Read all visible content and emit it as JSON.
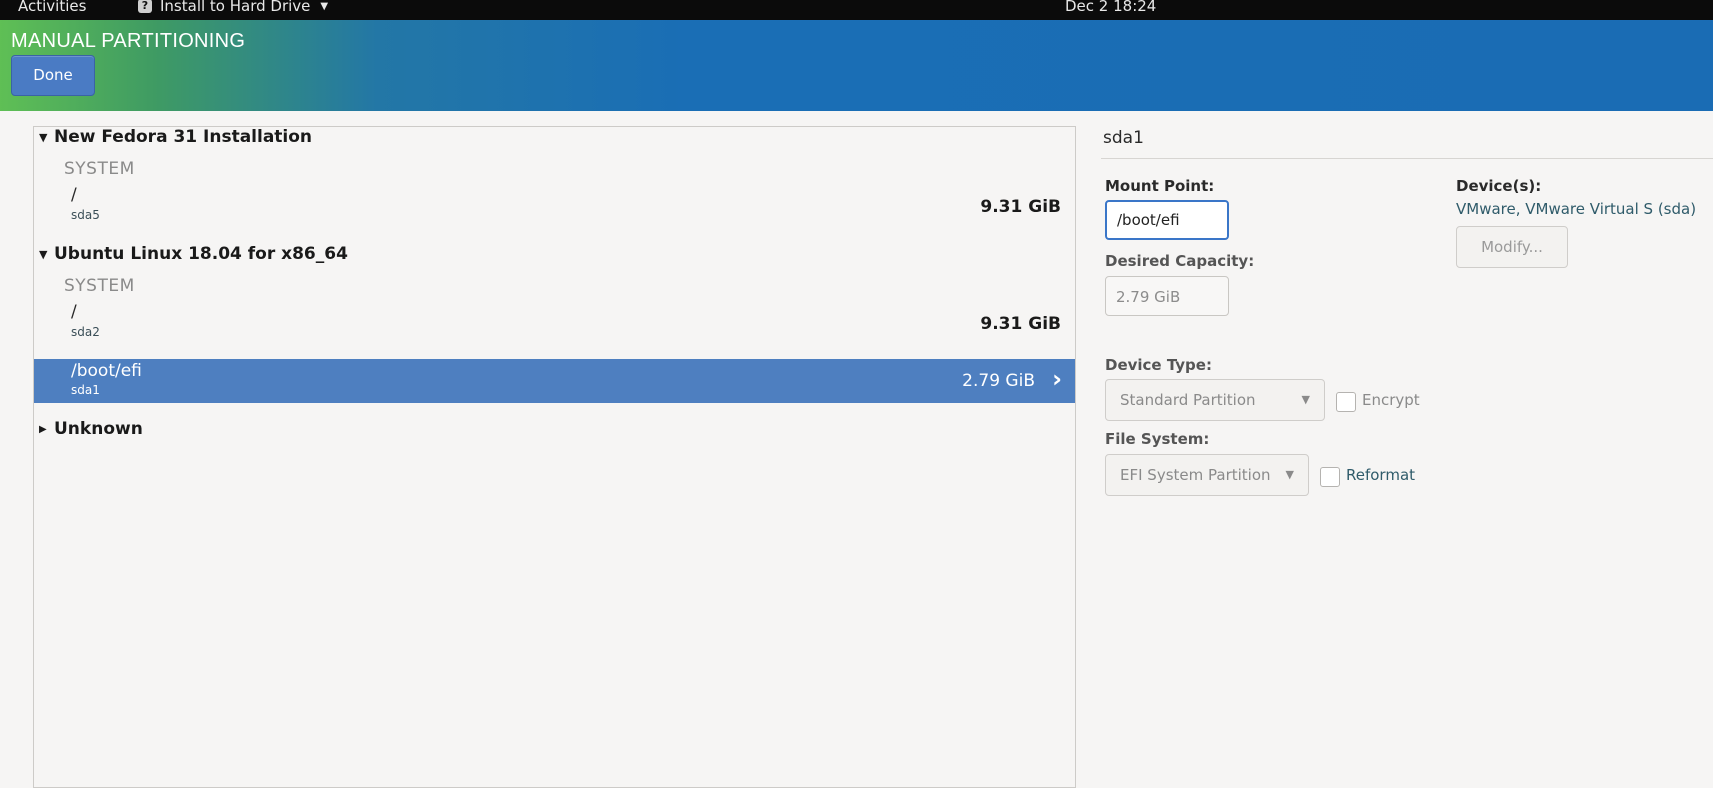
{
  "topbar": {
    "activities": "Activities",
    "app_name": "Install to Hard Drive",
    "clock": "Dec 2  18:24"
  },
  "header": {
    "title": "MANUAL PARTITIONING",
    "done_label": "Done"
  },
  "partition_groups": [
    {
      "name": "New Fedora 31 Installation",
      "expanded": true,
      "section_label": "SYSTEM",
      "partitions": [
        {
          "mount": "/",
          "device": "sda5",
          "size": "9.31 GiB",
          "selected": false
        }
      ]
    },
    {
      "name": "Ubuntu Linux 18.04 for x86_64",
      "expanded": true,
      "section_label": "SYSTEM",
      "partitions": [
        {
          "mount": "/",
          "device": "sda2",
          "size": "9.31 GiB",
          "selected": false
        },
        {
          "mount": "/boot/efi",
          "device": "sda1",
          "size": "2.79 GiB",
          "selected": true
        }
      ]
    },
    {
      "name": "Unknown",
      "expanded": false
    }
  ],
  "details": {
    "device_title": "sda1",
    "mount_point_label": "Mount Point:",
    "mount_point_value": "/boot/efi",
    "desired_capacity_label": "Desired Capacity:",
    "desired_capacity_value": "2.79 GiB",
    "devices_label": "Device(s):",
    "devices_value": "VMware, VMware Virtual S (sda)",
    "modify_label": "Modify...",
    "device_type_label": "Device Type:",
    "device_type_value": "Standard Partition",
    "encrypt_label": "Encrypt",
    "file_system_label": "File System:",
    "file_system_value": "EFI System Partition",
    "reformat_label": "Reformat"
  },
  "icons": {
    "expanded": "triangle-down-icon",
    "collapsed": "triangle-right-icon",
    "selected_row": "chevron-right-icon",
    "dropdown": "dropdown-arrow-icon"
  },
  "colors": {
    "header_start": "#5fbf55",
    "header_end": "#1a6cb4",
    "selection": "#4e7fc0",
    "done_button": "#4a7bc4"
  }
}
